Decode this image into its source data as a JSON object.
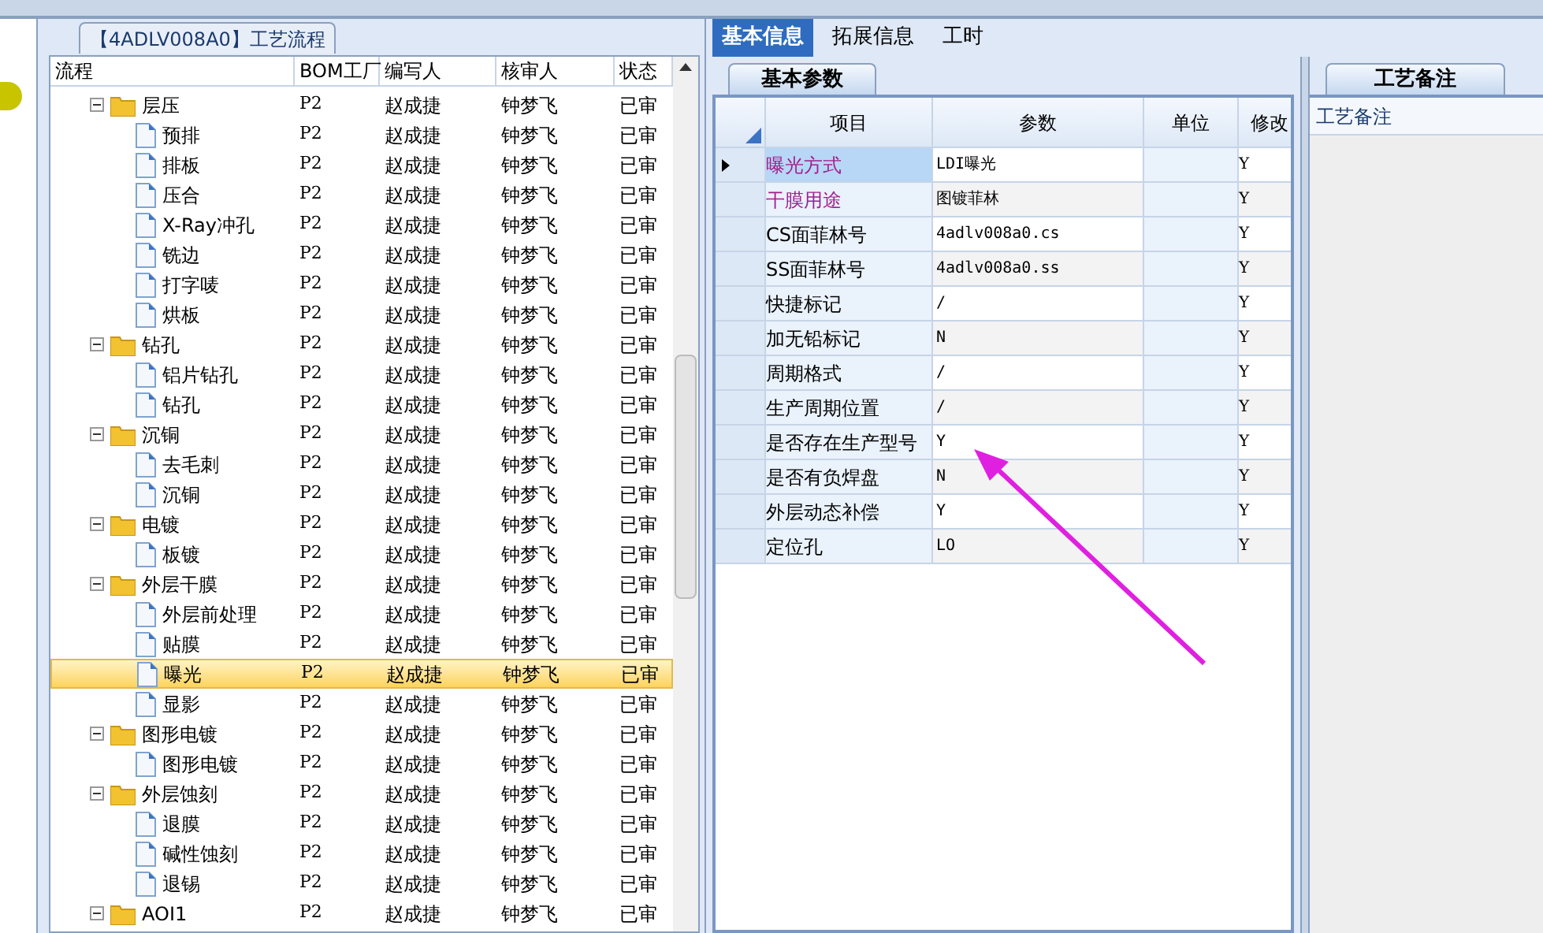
{
  "flow_panel": {
    "title": "【4ADLV008A0】工艺流程",
    "columns": [
      "流程",
      "BOM工厂",
      "编写人",
      "核审人",
      "状态"
    ],
    "rows": [
      {
        "name": "层压",
        "expanded": true,
        "selected": false,
        "bom": "P2",
        "writer": "赵成捷",
        "reviewer": "钟梦飞",
        "status": "已审",
        "children": [
          {
            "name": "预排",
            "selected": false,
            "bom": "P2",
            "writer": "赵成捷",
            "reviewer": "钟梦飞",
            "status": "已审"
          },
          {
            "name": "排板",
            "selected": false,
            "bom": "P2",
            "writer": "赵成捷",
            "reviewer": "钟梦飞",
            "status": "已审"
          },
          {
            "name": "压合",
            "selected": false,
            "bom": "P2",
            "writer": "赵成捷",
            "reviewer": "钟梦飞",
            "status": "已审"
          },
          {
            "name": "X-Ray冲孔",
            "selected": false,
            "bom": "P2",
            "writer": "赵成捷",
            "reviewer": "钟梦飞",
            "status": "已审"
          },
          {
            "name": "铣边",
            "selected": false,
            "bom": "P2",
            "writer": "赵成捷",
            "reviewer": "钟梦飞",
            "status": "已审"
          },
          {
            "name": "打字唛",
            "selected": false,
            "bom": "P2",
            "writer": "赵成捷",
            "reviewer": "钟梦飞",
            "status": "已审"
          },
          {
            "name": "烘板",
            "selected": false,
            "bom": "P2",
            "writer": "赵成捷",
            "reviewer": "钟梦飞",
            "status": "已审"
          }
        ]
      },
      {
        "name": "钻孔",
        "expanded": true,
        "selected": false,
        "bom": "P2",
        "writer": "赵成捷",
        "reviewer": "钟梦飞",
        "status": "已审",
        "children": [
          {
            "name": "铝片钻孔",
            "selected": false,
            "bom": "P2",
            "writer": "赵成捷",
            "reviewer": "钟梦飞",
            "status": "已审"
          },
          {
            "name": "钻孔",
            "selected": false,
            "bom": "P2",
            "writer": "赵成捷",
            "reviewer": "钟梦飞",
            "status": "已审"
          }
        ]
      },
      {
        "name": "沉铜",
        "expanded": true,
        "selected": false,
        "bom": "P2",
        "writer": "赵成捷",
        "reviewer": "钟梦飞",
        "status": "已审",
        "children": [
          {
            "name": "去毛刺",
            "selected": false,
            "bom": "P2",
            "writer": "赵成捷",
            "reviewer": "钟梦飞",
            "status": "已审"
          },
          {
            "name": "沉铜",
            "selected": false,
            "bom": "P2",
            "writer": "赵成捷",
            "reviewer": "钟梦飞",
            "status": "已审"
          }
        ]
      },
      {
        "name": "电镀",
        "expanded": true,
        "selected": false,
        "bom": "P2",
        "writer": "赵成捷",
        "reviewer": "钟梦飞",
        "status": "已审",
        "children": [
          {
            "name": "板镀",
            "selected": false,
            "bom": "P2",
            "writer": "赵成捷",
            "reviewer": "钟梦飞",
            "status": "已审"
          }
        ]
      },
      {
        "name": "外层干膜",
        "expanded": true,
        "selected": false,
        "bom": "P2",
        "writer": "赵成捷",
        "reviewer": "钟梦飞",
        "status": "已审",
        "children": [
          {
            "name": "外层前处理",
            "selected": false,
            "bom": "P2",
            "writer": "赵成捷",
            "reviewer": "钟梦飞",
            "status": "已审"
          },
          {
            "name": "贴膜",
            "selected": false,
            "bom": "P2",
            "writer": "赵成捷",
            "reviewer": "钟梦飞",
            "status": "已审"
          },
          {
            "name": "曝光",
            "selected": true,
            "bom": "P2",
            "writer": "赵成捷",
            "reviewer": "钟梦飞",
            "status": "已审"
          },
          {
            "name": "显影",
            "selected": false,
            "bom": "P2",
            "writer": "赵成捷",
            "reviewer": "钟梦飞",
            "status": "已审"
          }
        ]
      },
      {
        "name": "图形电镀",
        "expanded": true,
        "selected": false,
        "bom": "P2",
        "writer": "赵成捷",
        "reviewer": "钟梦飞",
        "status": "已审",
        "children": [
          {
            "name": "图形电镀",
            "selected": false,
            "bom": "P2",
            "writer": "赵成捷",
            "reviewer": "钟梦飞",
            "status": "已审"
          }
        ]
      },
      {
        "name": "外层蚀刻",
        "expanded": true,
        "selected": false,
        "bom": "P2",
        "writer": "赵成捷",
        "reviewer": "钟梦飞",
        "status": "已审",
        "children": [
          {
            "name": "退膜",
            "selected": false,
            "bom": "P2",
            "writer": "赵成捷",
            "reviewer": "钟梦飞",
            "status": "已审"
          },
          {
            "name": "碱性蚀刻",
            "selected": false,
            "bom": "P2",
            "writer": "赵成捷",
            "reviewer": "钟梦飞",
            "status": "已审"
          },
          {
            "name": "退锡",
            "selected": false,
            "bom": "P2",
            "writer": "赵成捷",
            "reviewer": "钟梦飞",
            "status": "已审"
          }
        ]
      },
      {
        "name": "AOI1",
        "expanded": true,
        "selected": false,
        "bom": "P2",
        "writer": "赵成捷",
        "reviewer": "钟梦飞",
        "status": "已审"
      }
    ]
  },
  "tabs": [
    {
      "label": "基本信息",
      "selected": true
    },
    {
      "label": "拓展信息",
      "selected": false
    },
    {
      "label": "工时",
      "selected": false
    }
  ],
  "params_panel": {
    "tab": "基本参数",
    "columns": [
      "项目",
      "参数",
      "单位",
      "修改"
    ],
    "rows": [
      {
        "item": "曝光方式",
        "color": "#a0208c",
        "param": "LDI曝光",
        "modify": "Y",
        "selected": true
      },
      {
        "item": "干膜用途",
        "color": "#a0208c",
        "param": "图镀菲林",
        "modify": "Y",
        "selected": false
      },
      {
        "item": "CS面菲林号",
        "color": "#000000",
        "param": "4adlv008a0.cs",
        "modify": "Y",
        "selected": false
      },
      {
        "item": "SS面菲林号",
        "color": "#000000",
        "param": "4adlv008a0.ss",
        "modify": "Y",
        "selected": false
      },
      {
        "item": "快捷标记",
        "color": "#000000",
        "param": "/",
        "modify": "Y",
        "selected": false
      },
      {
        "item": "加无铅标记",
        "color": "#000000",
        "param": "N",
        "modify": "Y",
        "selected": false
      },
      {
        "item": "周期格式",
        "color": "#000000",
        "param": "/",
        "modify": "Y",
        "selected": false
      },
      {
        "item": "生产周期位置",
        "color": "#000000",
        "param": "/",
        "modify": "Y",
        "selected": false
      },
      {
        "item": "是否存在生产型号",
        "color": "#000000",
        "param": "Y",
        "modify": "Y",
        "selected": false
      },
      {
        "item": "是否有负焊盘",
        "color": "#000000",
        "param": "N",
        "modify": "Y",
        "selected": false
      },
      {
        "item": "外层动态补偿",
        "color": "#000000",
        "param": "Y",
        "modify": "Y",
        "selected": false
      },
      {
        "item": "定位孔",
        "color": "#000000",
        "param": "LO",
        "modify": "Y",
        "selected": false
      }
    ]
  },
  "notes_panel": {
    "tab": "工艺备注",
    "header": "工艺备注"
  }
}
